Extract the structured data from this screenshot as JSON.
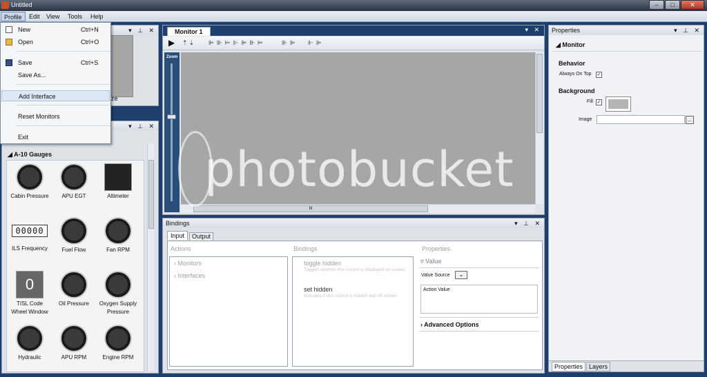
{
  "window": {
    "title": "Untitled",
    "minimize": "–",
    "maximize": "□",
    "close": "✕"
  },
  "menubar": {
    "items": [
      "Profile",
      "Edit",
      "View",
      "Tools",
      "Help"
    ]
  },
  "profile_menu": {
    "items": [
      {
        "label": "New",
        "shortcut": "Ctrl+N",
        "icon": "new-file-icon"
      },
      {
        "label": "Open",
        "shortcut": "Ctrl+O",
        "icon": "folder-open-icon"
      },
      {
        "label": "Save",
        "shortcut": "Ctrl+S",
        "icon": "save-icon"
      },
      {
        "label": "Save As...",
        "shortcut": ""
      },
      {
        "label": "Add Interface",
        "shortcut": ""
      },
      {
        "label": "Reset Monitors",
        "shortcut": ""
      },
      {
        "label": "Exit",
        "shortcut": ""
      }
    ]
  },
  "preview_panel": {
    "size_label": "Size"
  },
  "toolbox": {
    "category": "A-10 Gauges",
    "gauges": [
      {
        "label": "Cabin Pressure",
        "style": "round"
      },
      {
        "label": "APU EGT",
        "style": "round"
      },
      {
        "label": "Altimeter",
        "style": "square"
      },
      {
        "label": "ILS Frequency",
        "style": "digits",
        "digits": "00000"
      },
      {
        "label": "Fuel Flow",
        "style": "round"
      },
      {
        "label": "Fan RPM",
        "style": "round"
      },
      {
        "label": "TISL Code Wheel Window",
        "style": "square",
        "digits": "0"
      },
      {
        "label": "Oil Pressure",
        "style": "round"
      },
      {
        "label": "Oxygen Supply Pressure",
        "style": "round"
      },
      {
        "label": "Hydraulic",
        "style": "round"
      },
      {
        "label": "APU RPM",
        "style": "round"
      },
      {
        "label": "Engine RPM",
        "style": "round"
      }
    ]
  },
  "monitor": {
    "tab": "Monitor 1",
    "zoom_label": "Zoom",
    "scroll_grip": "III"
  },
  "bindings": {
    "title": "Bindings",
    "tabs": [
      "Input",
      "Output"
    ],
    "actions_header": "Actions",
    "actions": [
      "Monitors",
      "Interfaces"
    ],
    "bindings_header": "Bindings",
    "bindings_list": [
      {
        "name": "toggle hidden",
        "desc": "Toggles whether this control is displayed on screen."
      },
      {
        "name": "set hidden",
        "desc": "Indicates if this control is hidden and off screen."
      }
    ],
    "properties_header": "Properties",
    "value_section": "Value",
    "value_source_label": "Value Source",
    "action_value_label": "Action Value",
    "advanced_options": "Advanced Options"
  },
  "properties": {
    "title": "Properties",
    "section": "Monitor",
    "behavior_header": "Behavior",
    "always_on_top_label": "Always On Top",
    "always_on_top": true,
    "background_header": "Background",
    "fill_label": "Fill",
    "fill_checked": true,
    "fill_color": "#b4b4b4",
    "image_label": "Image",
    "image_value": "",
    "browse_label": "...",
    "bottom_tabs": [
      "Properties",
      "Layers"
    ]
  },
  "watermark": "photobucket",
  "colors": {
    "accent": "#1e3f6b",
    "canvas": "#a6a6a6"
  }
}
